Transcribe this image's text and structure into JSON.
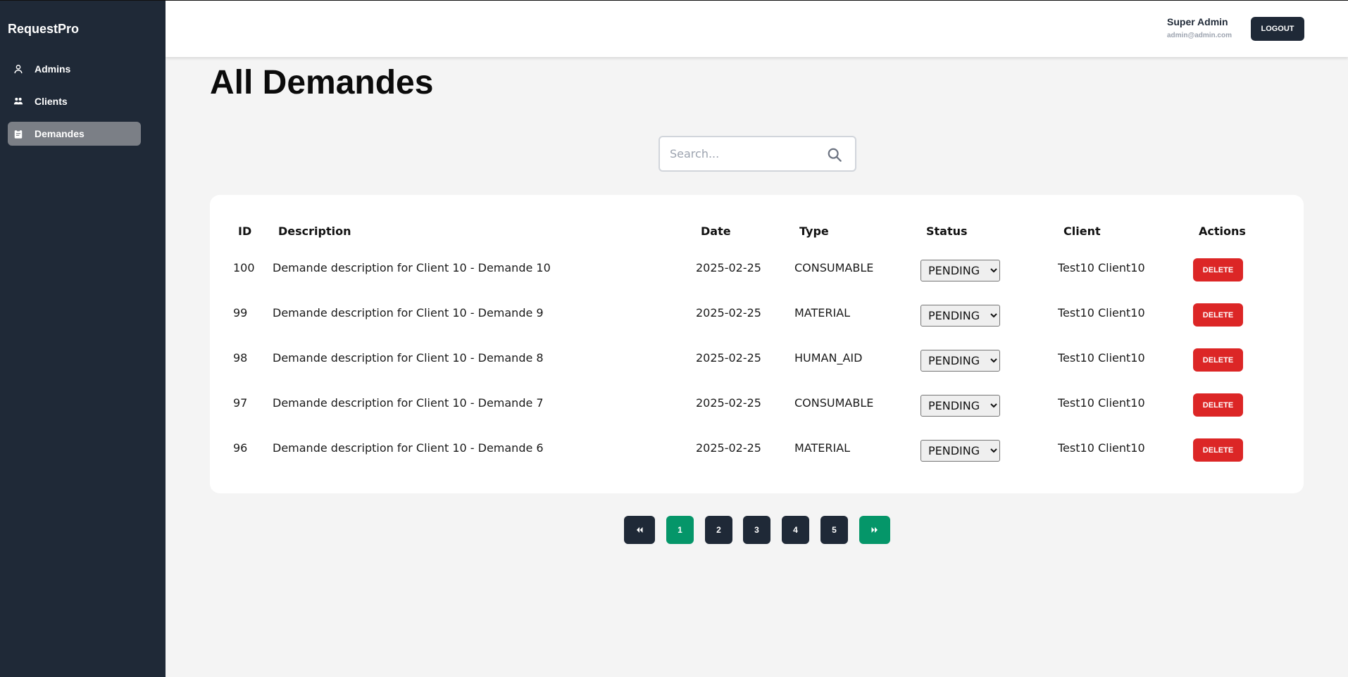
{
  "app": {
    "brand": "RequestPro"
  },
  "sidebar": {
    "items": [
      {
        "label": "Admins",
        "icon": "user-icon",
        "active": false
      },
      {
        "label": "Clients",
        "icon": "users-icon",
        "active": false
      },
      {
        "label": "Demandes",
        "icon": "clipboard-icon",
        "active": true
      }
    ]
  },
  "header": {
    "user_name": "Super Admin",
    "user_email": "admin@admin.com",
    "logout_label": "LOGOUT"
  },
  "main": {
    "title": "All Demandes",
    "search": {
      "placeholder": "Search...",
      "value": ""
    }
  },
  "table": {
    "columns": [
      "ID",
      "Description",
      "Date",
      "Type",
      "Status",
      "Client",
      "Actions"
    ],
    "status_options": [
      "PENDING"
    ],
    "delete_label": "DELETE",
    "rows": [
      {
        "id": "100",
        "description": "Demande description for Client 10 - Demande 10",
        "date": "2025-02-25",
        "type": "CONSUMABLE",
        "status": "PENDING",
        "client": "Test10 Client10"
      },
      {
        "id": "99",
        "description": "Demande description for Client 10 - Demande 9",
        "date": "2025-02-25",
        "type": "MATERIAL",
        "status": "PENDING",
        "client": "Test10 Client10"
      },
      {
        "id": "98",
        "description": "Demande description for Client 10 - Demande 8",
        "date": "2025-02-25",
        "type": "HUMAN_AID",
        "status": "PENDING",
        "client": "Test10 Client10"
      },
      {
        "id": "97",
        "description": "Demande description for Client 10 - Demande 7",
        "date": "2025-02-25",
        "type": "CONSUMABLE",
        "status": "PENDING",
        "client": "Test10 Client10"
      },
      {
        "id": "96",
        "description": "Demande description for Client 10 - Demande 6",
        "date": "2025-02-25",
        "type": "MATERIAL",
        "status": "PENDING",
        "client": "Test10 Client10"
      }
    ]
  },
  "pagination": {
    "first_icon": "double-chevron-left-icon",
    "last_icon": "double-chevron-right-icon",
    "pages": [
      "1",
      "2",
      "3",
      "4",
      "5"
    ],
    "current_page": "1"
  },
  "colors": {
    "sidebar_bg": "#1f2937",
    "accent_green": "#059669",
    "danger": "#dc2626"
  }
}
